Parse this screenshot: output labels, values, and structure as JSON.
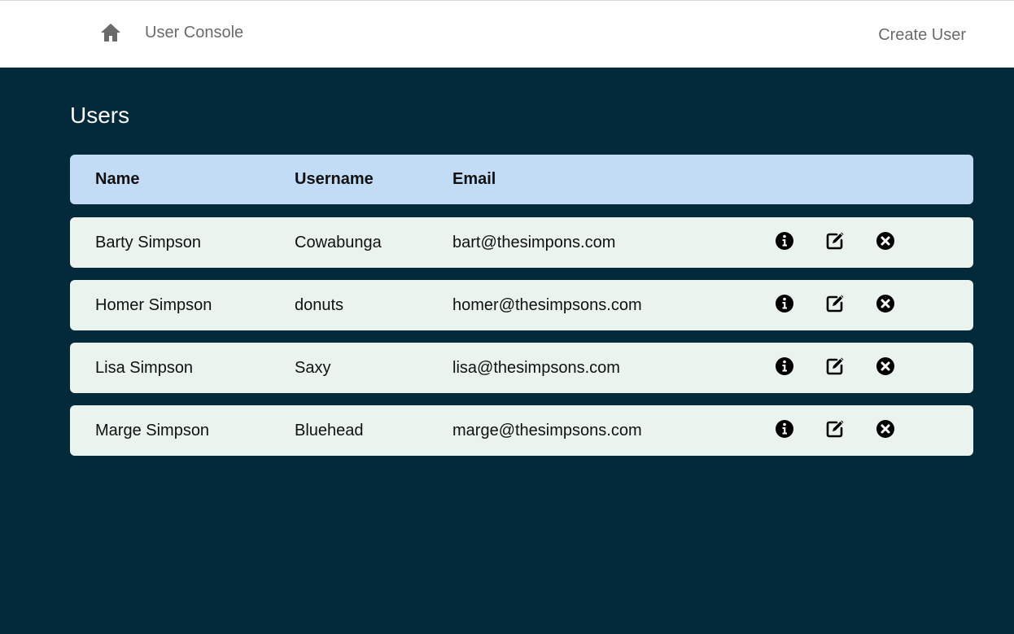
{
  "navbar": {
    "home_icon": "home-icon",
    "brand": "User Console",
    "create_user": "Create User"
  },
  "page": {
    "title": "Users"
  },
  "table": {
    "headers": {
      "name": "Name",
      "username": "Username",
      "email": "Email"
    },
    "rows": [
      {
        "name": "Barty Simpson",
        "username": "Cowabunga",
        "email": "bart@thesimpons.com"
      },
      {
        "name": "Homer Simpson",
        "username": "donuts",
        "email": "homer@thesimpsons.com"
      },
      {
        "name": "Lisa Simpson",
        "username": "Saxy",
        "email": "lisa@thesimpsons.com"
      },
      {
        "name": "Marge Simpson",
        "username": "Bluehead",
        "email": "marge@thesimpsons.com"
      }
    ],
    "row_actions": [
      "info-icon",
      "edit-icon",
      "delete-icon"
    ]
  },
  "colors": {
    "background": "#032a3a",
    "header_row": "#c2dcf6",
    "data_row": "#eaf3ed",
    "nav_text": "#6b6b6b"
  }
}
